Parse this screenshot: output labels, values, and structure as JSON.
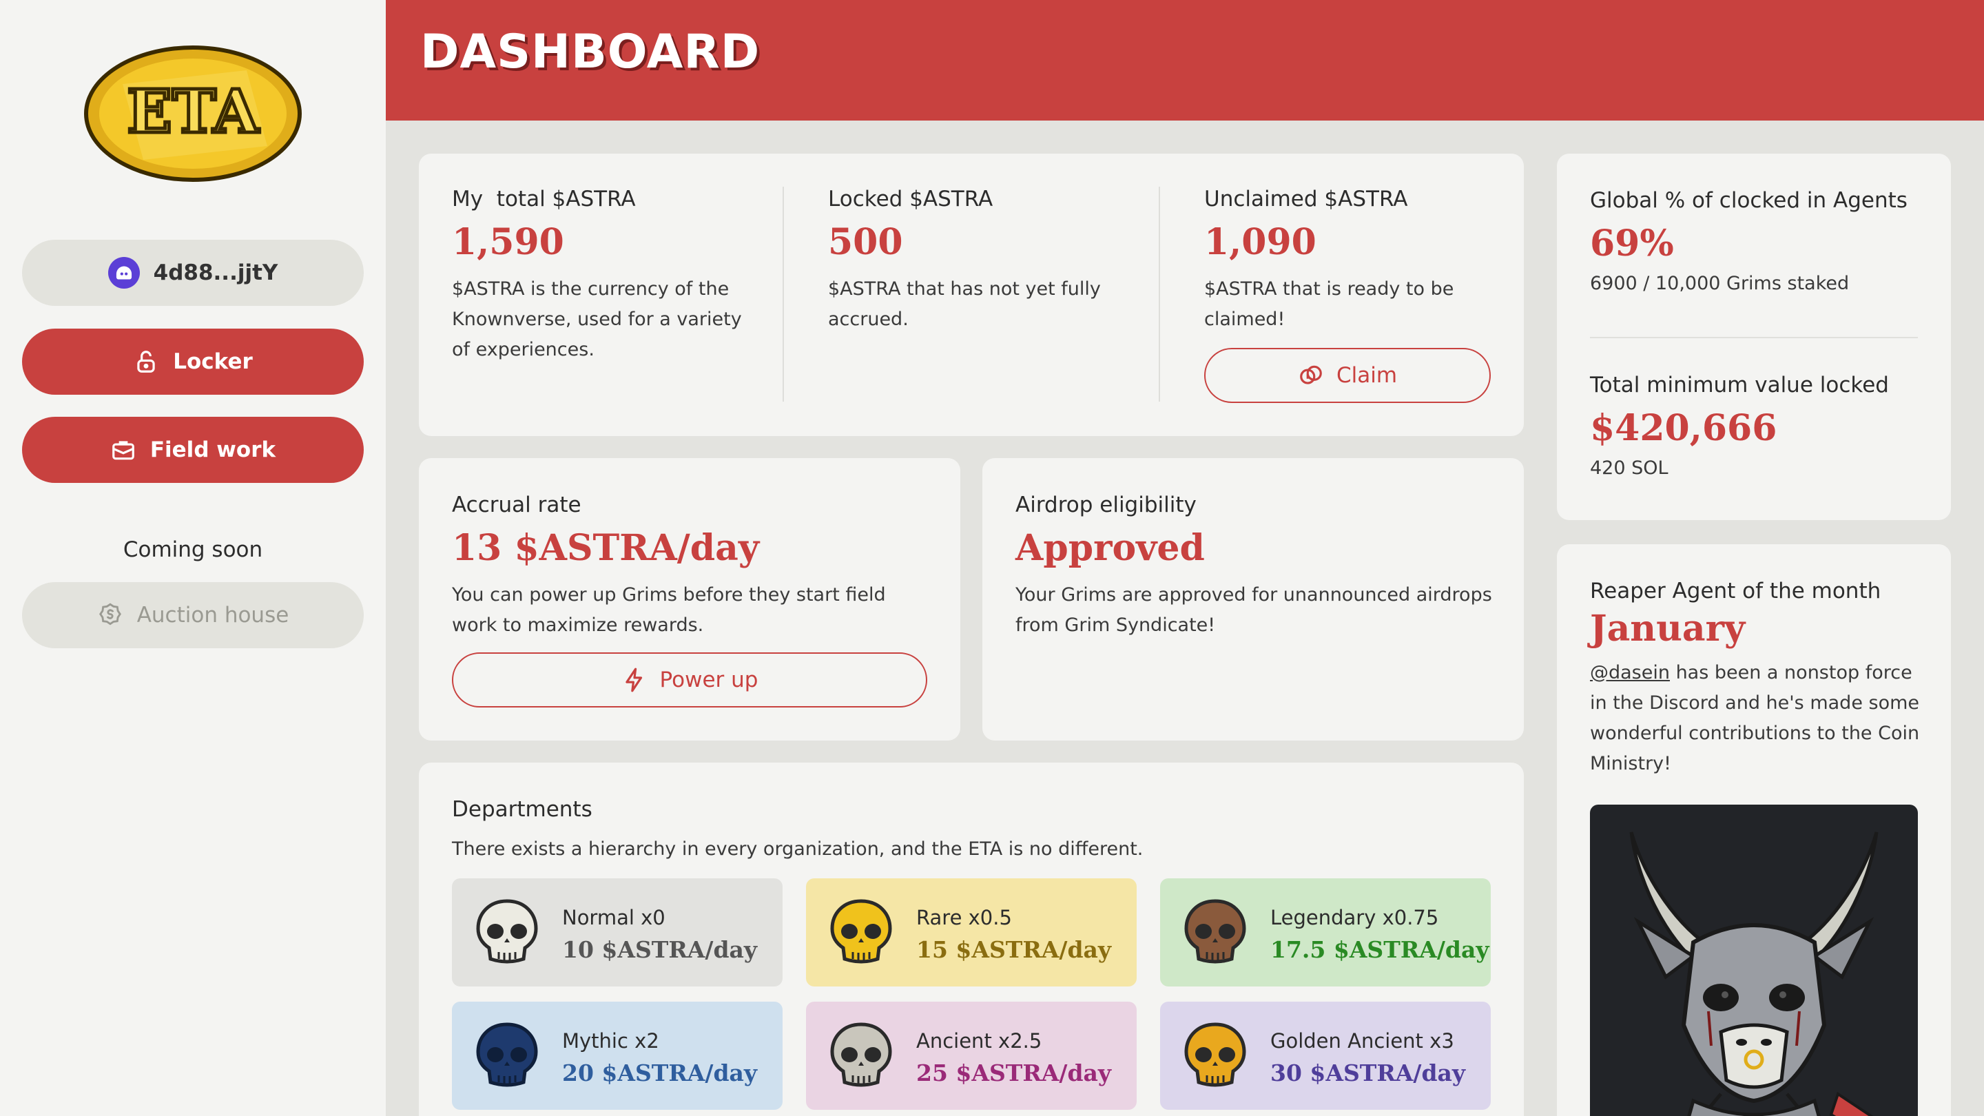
{
  "app": {
    "logo_text": "ETA",
    "header_title": "DASHBOARD",
    "colors": {
      "accent": "#c8413f",
      "sidebar_bg": "#f4f4f2",
      "page_bg": "#e3e3df",
      "wallet": "#5b3fd6"
    }
  },
  "sidebar": {
    "wallet_label": "4d88...jjtY",
    "locker_label": "Locker",
    "fieldwork_label": "Field work",
    "coming_soon_label": "Coming soon",
    "auction_label": "Auction house",
    "icons": [
      "ghost-wallet-icon",
      "lock-icon",
      "briefcase-icon",
      "coin-dollar-icon"
    ]
  },
  "stats": {
    "total": {
      "label": "My  total $ASTRA",
      "value": "1,590",
      "desc": "$ASTRA is the currency of the Knownverse, used for a variety of experiences."
    },
    "locked": {
      "label": "Locked $ASTRA",
      "value": "500",
      "desc": "$ASTRA that has not yet fully accrued."
    },
    "unclaimed": {
      "label": "Unclaimed $ASTRA",
      "value": "1,090",
      "desc": "$ASTRA that is ready to be claimed!",
      "button": "Claim"
    }
  },
  "accrual": {
    "label": "Accrual rate",
    "value": "13 $ASTRA/day",
    "desc": "You can power up Grims before they start field work to maximize rewards.",
    "button": "Power up"
  },
  "airdrop": {
    "label": "Airdrop eligibility",
    "value": "Approved",
    "desc": "Your Grims are approved for unannounced airdrops from Grim Syndicate!"
  },
  "departments": {
    "title": "Departments",
    "desc": "There exists a hierarchy in every organization, and the ETA is no different.",
    "tiers": [
      {
        "name": "Normal x0",
        "rate": "10 $ASTRA/day",
        "bg": "#e2e2df",
        "color": "#555555",
        "skull": "#ecebe2",
        "stroke": "#2a2a2a"
      },
      {
        "name": "Rare x0.5",
        "rate": "15 $ASTRA/day",
        "bg": "#f5e6a6",
        "color": "#8a6d10",
        "skull": "#f0c21c",
        "stroke": "#2a2a2a"
      },
      {
        "name": "Legendary x0.75",
        "rate": "17.5 $ASTRA/day",
        "bg": "#cfe8c8",
        "color": "#2a8a24",
        "skull": "#8a5a3c",
        "stroke": "#2a2a2a"
      },
      {
        "name": "Mythic x2",
        "rate": "20 $ASTRA/day",
        "bg": "#cfe0ee",
        "color": "#2f5e9e",
        "skull": "#1e3a6e",
        "stroke": "#0f1f3a"
      },
      {
        "name": "Ancient x2.5",
        "rate": "25 $ASTRA/day",
        "bg": "#ead4e3",
        "color": "#9a2a78",
        "skull": "#c9c6bc",
        "stroke": "#2a2a2a"
      },
      {
        "name": "Golden Ancient x3",
        "rate": "30 $ASTRA/day",
        "bg": "#dcd6ec",
        "color": "#4f3e9a",
        "skull": "#e9a81e",
        "stroke": "#2a2a2a"
      }
    ]
  },
  "global": {
    "label": "Global % of clocked in Agents",
    "value": "69%",
    "sub": "6900 / 10,000 Grims staked",
    "tvl_label": "Total minimum value locked",
    "tvl_value": "$420,666",
    "tvl_sub": "420 SOL"
  },
  "agent": {
    "label": "Reaper Agent of the month",
    "month": "January",
    "handle": "@dasein",
    "desc": " has been a nonstop force in the Discord and he's made some wonderful contributions to the Coin Ministry!"
  }
}
